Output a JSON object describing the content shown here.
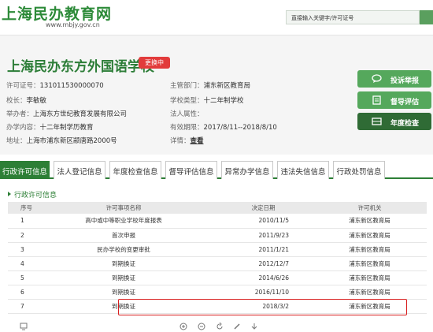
{
  "site": {
    "title": "上海民办教育网",
    "url": "www.mbjy.gov.cn",
    "search_placeholder": "直接输入关键字/许可证号"
  },
  "school": {
    "name": "上海民办东方外国语学校",
    "change_badge": "更换中",
    "fields": {
      "license_label": "许可证号：",
      "license": "131011530000070",
      "authority_label": "主管部门：",
      "authority": "浦东新区教育局",
      "principal_label": "校长：",
      "principal": "李敏敏",
      "type_label": "学校类型：",
      "type": "十二年制学校",
      "sponsor_label": "举办者：",
      "sponsor": "上海东方世纪教育发展有限公司",
      "legal_label": "法人属性：",
      "legal": "",
      "content_label": "办学内容：",
      "content": "十二年制学历教育",
      "valid_label": "有效期限：",
      "valid": "2017/8/11--2018/8/10",
      "address_label": "地址：",
      "address": "上海市浦东新区颛唐路2000号",
      "detail_label": "详情：",
      "detail_link": "查看"
    }
  },
  "side_buttons": [
    {
      "label": "投诉举报",
      "color": "#55a85c",
      "icon": "chat-icon"
    },
    {
      "label": "督导评估",
      "color": "#55a85c",
      "icon": "clipboard-icon"
    },
    {
      "label": "年度检查",
      "color": "#2f6b35",
      "icon": "inbox-icon"
    }
  ],
  "tabs": [
    "行政许可信息",
    "法人登记信息",
    "年度检查信息",
    "督导评估信息",
    "异常办学信息",
    "违法失信信息",
    "行政处罚信息"
  ],
  "active_tab": 0,
  "section_title": "行政许可信息",
  "table": {
    "headers": [
      "序号",
      "许可事项名称",
      "决定日期",
      "许可机关"
    ],
    "rows": [
      [
        "1",
        "高中或中等职业学校年度报表",
        "2010/11/5",
        "浦东新区教育局"
      ],
      [
        "2",
        "首次申报",
        "2011/9/23",
        "浦东新区教育局"
      ],
      [
        "3",
        "民办学校的变更审批",
        "2011/1/21",
        "浦东新区教育局"
      ],
      [
        "4",
        "到期换证",
        "2012/12/7",
        "浦东新区教育局"
      ],
      [
        "5",
        "到期换证",
        "2014/6/26",
        "浦东新区教育局"
      ],
      [
        "6",
        "到期换证",
        "2016/11/10",
        "浦东新区教育局"
      ],
      [
        "7",
        "到期换证",
        "2018/3/2",
        "浦东新区教育局"
      ]
    ]
  },
  "colors": {
    "brand_green": "#2d7f36",
    "highlight_red": "#d81e1e"
  },
  "bottom_icons": [
    "screen-icon",
    "zoom-in-icon",
    "zoom-out-icon",
    "refresh-icon",
    "pencil-icon",
    "download-icon"
  ]
}
